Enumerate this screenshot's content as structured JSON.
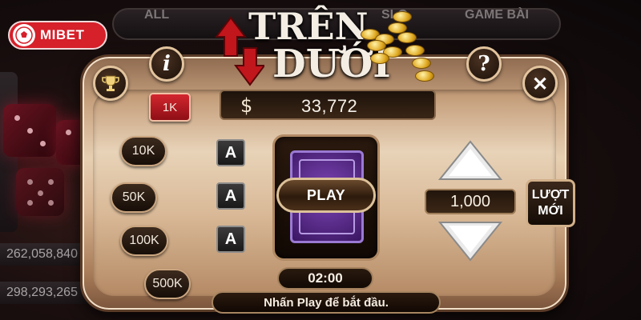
{
  "lobby": {
    "tabs": [
      "ALL",
      "SLO",
      "GAME BÀI"
    ]
  },
  "brand": {
    "logo_text": "MIBET"
  },
  "side_balances": [
    "262,058,840",
    "298,293,265"
  ],
  "game": {
    "title_line1": "TRÊN",
    "title_line2": "DƯỚI",
    "balance_symbol": "$",
    "balance": "33,772",
    "chips": [
      {
        "label": "1K",
        "selected": true
      },
      {
        "label": "10K",
        "selected": false
      },
      {
        "label": "50K",
        "selected": false
      },
      {
        "label": "100K",
        "selected": false
      },
      {
        "label": "500K",
        "selected": false
      }
    ],
    "a_cards": [
      "A",
      "A",
      "A"
    ],
    "play_label": "PLAY",
    "timer": "02:00",
    "message": "Nhấn Play để bắt đầu.",
    "bet_amount": "1,000",
    "next_line1": "LƯỢT",
    "next_line2": "MỚI",
    "info_label": "i",
    "help_label": "?",
    "close_label": "✕"
  },
  "colors": {
    "accent_red": "#d6202a",
    "panel_gold": "#e7cfb2",
    "card_purple": "#7f47b8"
  }
}
